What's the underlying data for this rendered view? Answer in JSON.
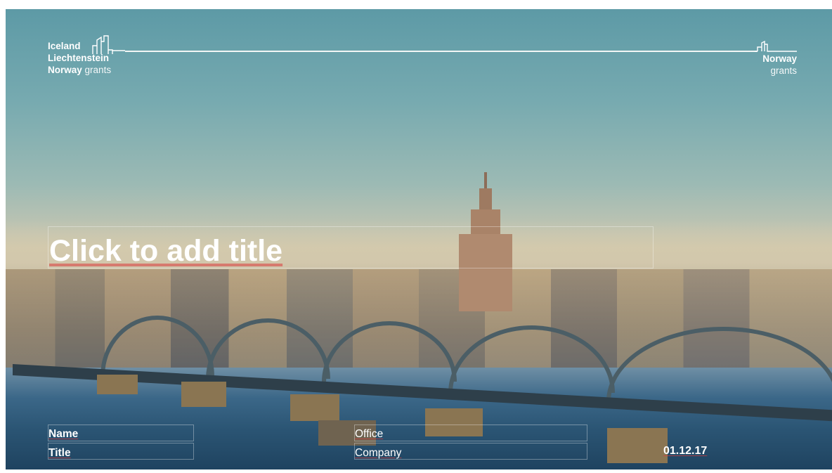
{
  "logo_left": {
    "line1": "Iceland",
    "line2": "Liechtenstein",
    "line3_bold": "Norway",
    "line3_light": "grants"
  },
  "logo_right": {
    "bold": "Norway",
    "light": "grants"
  },
  "title": {
    "text": "Click to add title"
  },
  "footer": {
    "name": "Name",
    "title": "Title",
    "office": "Office",
    "company": "Company",
    "date": "01.12.17"
  }
}
